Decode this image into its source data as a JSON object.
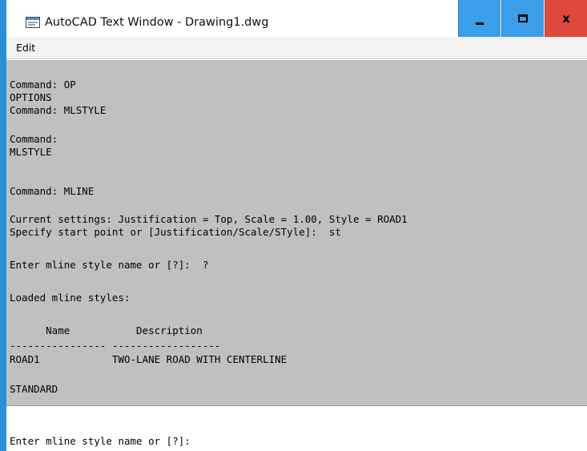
{
  "window": {
    "title": "AutoCAD Text Window - Drawing1.dwg",
    "accent": "#2b8fd6",
    "close_color": "#e0483b",
    "icon": "window-app-icon"
  },
  "menu": {
    "edit_label": "Edit"
  },
  "history": {
    "lines": [
      "Command: OP",
      "OPTIONS",
      "Command: MLSTYLE",
      "",
      "Command:",
      "MLSTYLE",
      "",
      "Command: MLINE",
      "",
      "Current settings: Justification = Top, Scale = 1.00, Style = ROAD1",
      "Specify start point or [Justification/Scale/STyle]:  st",
      "",
      "Enter mline style name or [?]:  ?",
      "",
      "Loaded mline styles:",
      "",
      "      Name           Description",
      "---------------- ------------------",
      "ROAD1            TWO-LANE ROAD WITH CENTERLINE",
      "",
      "STANDARD"
    ]
  },
  "input": {
    "prompt": "Enter mline style name or [?]:"
  }
}
